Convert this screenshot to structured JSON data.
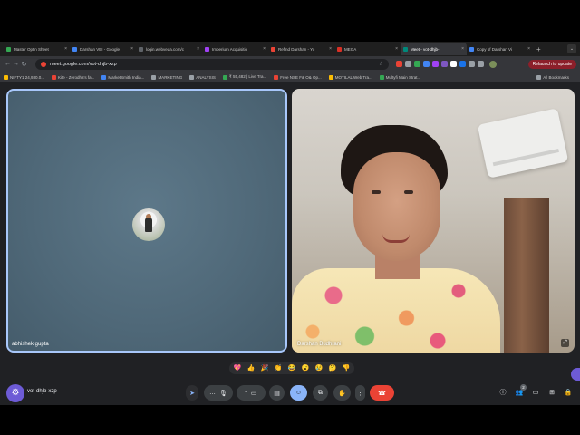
{
  "tabs": [
    {
      "title": "Master Optin Sheet",
      "color": "#34a853",
      "active": false
    },
    {
      "title": "Darshan VBI - Google",
      "color": "#4285f4",
      "active": false
    },
    {
      "title": "login.webveda.com/c",
      "color": "#5f6368",
      "active": false
    },
    {
      "title": "Imperium Acquisitio",
      "color": "#a142f4",
      "active": false
    },
    {
      "title": "Refind Darshan - Yo",
      "color": "#ea4335",
      "active": false
    },
    {
      "title": "MEGA",
      "color": "#d93025",
      "active": false
    },
    {
      "title": "Meet - vot-dhjb-",
      "color": "#00897b",
      "active": true
    },
    {
      "title": "Copy of Darshan Vi",
      "color": "#4285f4",
      "active": false
    }
  ],
  "toolbar": {
    "url": "meet.google.com/vot-dhjb-xzp",
    "relaunch_label": "Relaunch to update"
  },
  "bookmarks": [
    {
      "label": "NIFTY1 24,930.0...",
      "color": "#fbbc04"
    },
    {
      "label": "Kite - Zerodha's fa...",
      "color": "#ea4335"
    },
    {
      "label": "MarketSmith India...",
      "color": "#4285f4"
    },
    {
      "label": "MARKETING",
      "color": "#9aa0a6"
    },
    {
      "label": "ANALYSIS",
      "color": "#9aa0a6"
    },
    {
      "label": "₹ 55,482 | Live Tra...",
      "color": "#34a853"
    },
    {
      "label": "Free NSE F& O& Op...",
      "color": "#ea4335"
    },
    {
      "label": "MOTILAL Web Tra...",
      "color": "#fbbc04"
    },
    {
      "label": "Multyfi Main Strat...",
      "color": "#34a853"
    }
  ],
  "bookmarks_all": "All Bookmarks",
  "meet": {
    "left_participant": "abhishek gupta",
    "right_participant": "Darshan Budhrani",
    "meeting_code": "vot-dhjb-xzp",
    "participants_count": "2"
  },
  "reactions": [
    "💖",
    "👍",
    "🎉",
    "👏",
    "😂",
    "😮",
    "😢",
    "🤔",
    "👎"
  ],
  "accent_colors": {
    "selected_border": "#a8c7fa",
    "end_call": "#ea4335",
    "active_control": "#8ab4f8",
    "fab": "#6d5bd6"
  }
}
